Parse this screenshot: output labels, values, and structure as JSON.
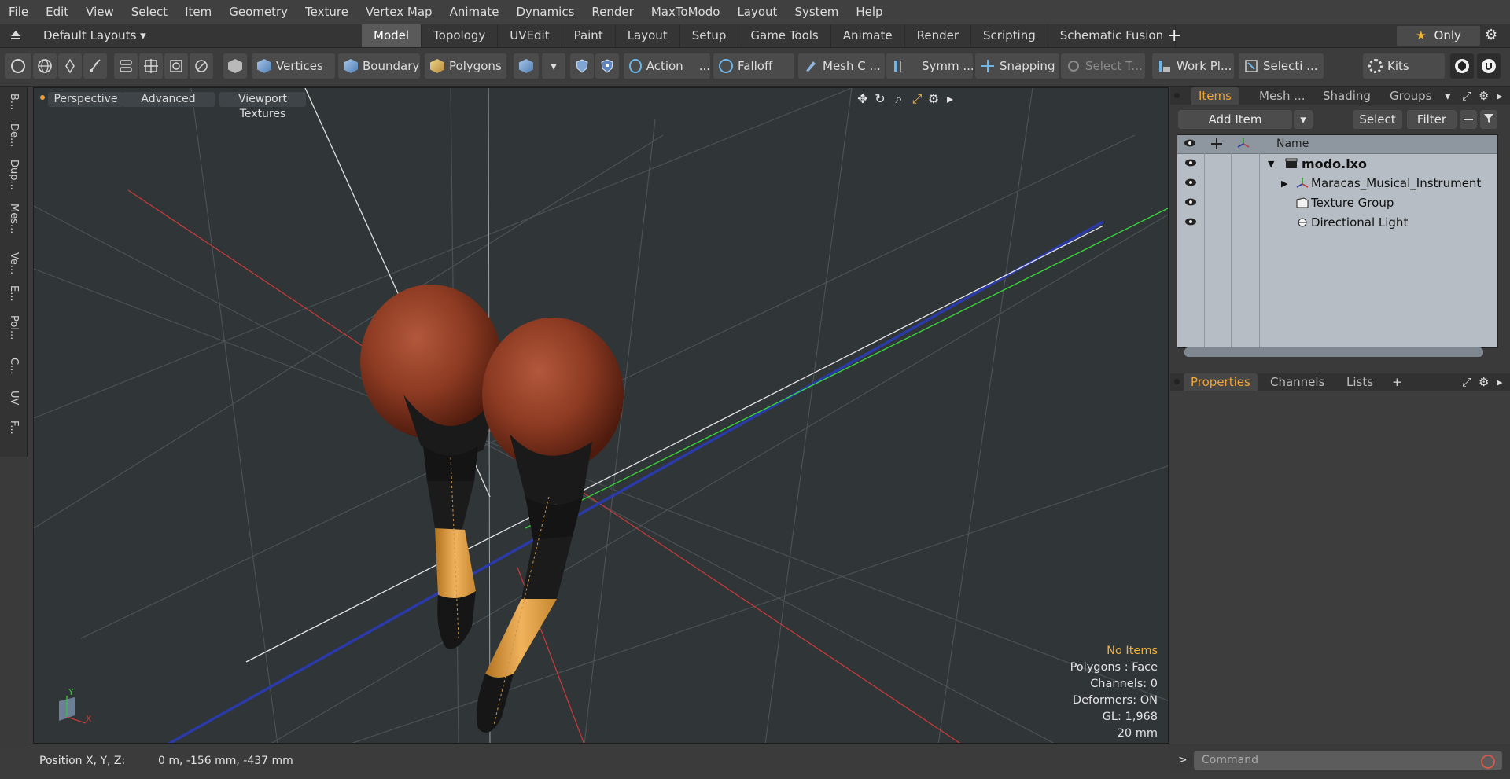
{
  "menubar": [
    "File",
    "Edit",
    "View",
    "Select",
    "Item",
    "Geometry",
    "Texture",
    "Vertex Map",
    "Animate",
    "Dynamics",
    "Render",
    "MaxToModo",
    "Layout",
    "System",
    "Help"
  ],
  "layoutbar": {
    "layout_name": "Default Layouts ▾",
    "tabs": [
      "Model",
      "Topology",
      "UVEdit",
      "Paint",
      "Layout",
      "Setup",
      "Game Tools",
      "Animate",
      "Render",
      "Scripting",
      "Schematic Fusion"
    ],
    "active_tab": "Model",
    "plus": "+",
    "only_label": "Only",
    "only_star": "★",
    "gear": "⚙"
  },
  "toolbar": {
    "vertices": "Vertices",
    "boundary": "Boundary",
    "polygons": "Polygons",
    "action": "Action",
    "action_more": "...",
    "falloff": "Falloff",
    "mesh_c": "Mesh C ...",
    "symm": "Symm ...",
    "snapping": "Snapping",
    "select_t": "Select T...",
    "work_pl": "Work Pl...",
    "selecti": "Selecti ...",
    "kits": "Kits",
    "dropdown_arrow": "▾"
  },
  "leftstrip": [
    "B...",
    "De...",
    "Dup...",
    "Mes...",
    "Ve...",
    "E...",
    "Pol...",
    "C...",
    "UV",
    "F..."
  ],
  "viewport": {
    "perspective": "Perspective",
    "advanced": "Advanced",
    "textures": "Viewport Textures",
    "ctrl_move": "✥",
    "ctrl_rotate": "↻",
    "ctrl_zoom": "⌕",
    "ctrl_fit": "⤢",
    "ctrl_gear": "⚙",
    "ctrl_more": "▸",
    "info": {
      "items": "No Items",
      "polygons": "Polygons : Face",
      "channels": "Channels: 0",
      "deformers": "Deformers: ON",
      "gl": "GL: 1,968",
      "scale": "20 mm"
    },
    "axis_x": "X",
    "axis_y": "Y"
  },
  "status": {
    "label": "Position X, Y, Z:",
    "value": "0 m, -156 mm, -437 mm"
  },
  "itempanel": {
    "tabs": [
      "Items",
      "Mesh ...",
      "Shading",
      "Groups"
    ],
    "active_tab": "Items",
    "add_item": "Add Item",
    "select": "Select",
    "filter": "Filter",
    "col_name": "Name",
    "rows": [
      {
        "label": "modo.lxo",
        "expander": "▼"
      },
      {
        "label": "Maracas_Musical_Instrument",
        "expander": "▶"
      },
      {
        "label": "Texture Group",
        "expander": ""
      },
      {
        "label": "Directional Light",
        "expander": ""
      }
    ]
  },
  "proppanel": {
    "tabs": [
      "Properties",
      "Channels",
      "Lists"
    ],
    "active_tab": "Properties",
    "plus": "+"
  },
  "command": {
    "placeholder": "Command",
    "prompt": ">"
  },
  "colors": {
    "accent_orange": "#f0a538",
    "axis_red": "#c23a3a",
    "axis_green": "#38d83a",
    "axis_blue": "#2a3aa8"
  }
}
